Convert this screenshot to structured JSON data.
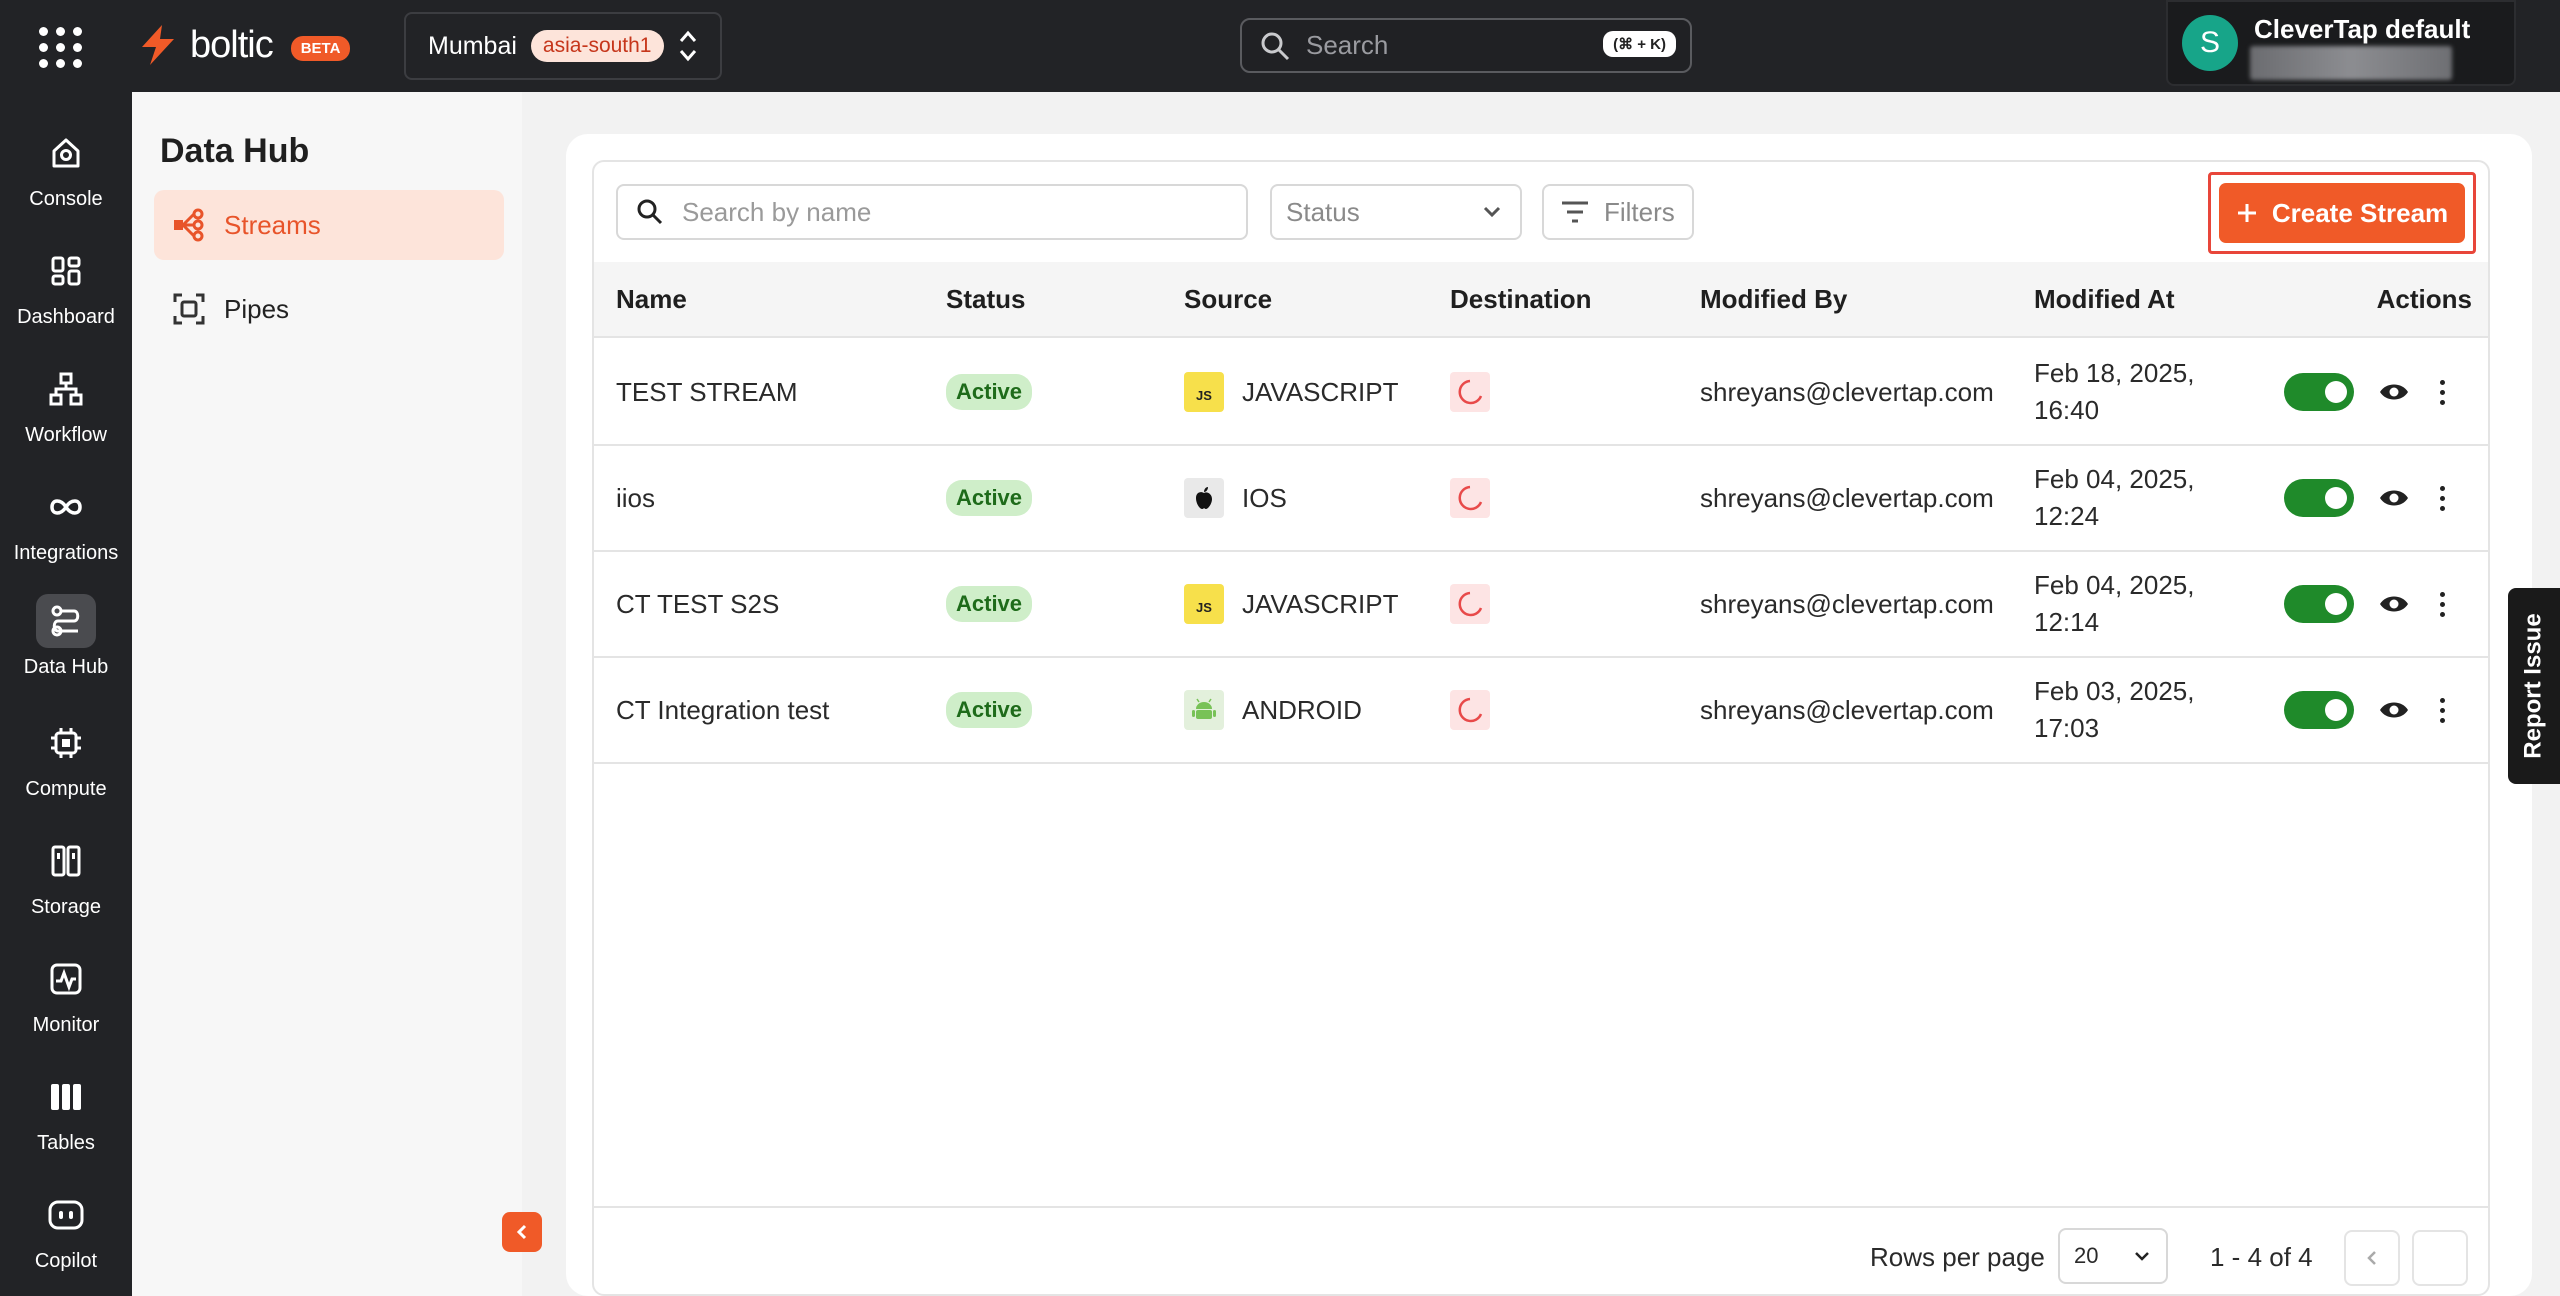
{
  "topbar": {
    "brand": "boltic",
    "beta_label": "BETA",
    "region_name": "Mumbai",
    "region_code": "asia-south1",
    "search_placeholder": "Search",
    "search_shortcut": "(⌘ + K)",
    "account_initial": "S",
    "account_name": "CleverTap default"
  },
  "rail": {
    "items": [
      {
        "label": "Console",
        "icon": "console-icon"
      },
      {
        "label": "Dashboard",
        "icon": "dashboard-icon"
      },
      {
        "label": "Workflow",
        "icon": "workflow-icon"
      },
      {
        "label": "Integrations",
        "icon": "integrations-icon"
      },
      {
        "label": "Data Hub",
        "icon": "data-hub-icon",
        "active": true
      },
      {
        "label": "Compute",
        "icon": "compute-icon"
      },
      {
        "label": "Storage",
        "icon": "storage-icon"
      },
      {
        "label": "Monitor",
        "icon": "monitor-icon"
      },
      {
        "label": "Tables",
        "icon": "tables-icon"
      },
      {
        "label": "Copilot",
        "icon": "copilot-icon"
      }
    ]
  },
  "subnav": {
    "title": "Data Hub",
    "items": [
      {
        "label": "Streams",
        "icon": "streams-icon",
        "active": true
      },
      {
        "label": "Pipes",
        "icon": "pipes-icon"
      }
    ]
  },
  "toolbar": {
    "search_placeholder": "Search by name",
    "status_placeholder": "Status",
    "filters_label": "Filters",
    "create_label": "Create Stream"
  },
  "table": {
    "columns": [
      "Name",
      "Status",
      "Source",
      "Destination",
      "Modified By",
      "Modified At",
      "Actions"
    ],
    "rows": [
      {
        "name": "TEST STREAM",
        "status": "Active",
        "source": "JAVASCRIPT",
        "source_icon": "javascript-icon",
        "modified_by": "shreyans@clevertap.com",
        "modified_at_1": "Feb 18, 2025,",
        "modified_at_2": "16:40",
        "enabled": true
      },
      {
        "name": "iios",
        "status": "Active",
        "source": "IOS",
        "source_icon": "apple-icon",
        "modified_by": "shreyans@clevertap.com",
        "modified_at_1": "Feb 04, 2025,",
        "modified_at_2": "12:24",
        "enabled": true
      },
      {
        "name": "CT TEST S2S",
        "status": "Active",
        "source": "JAVASCRIPT",
        "source_icon": "javascript-icon",
        "modified_by": "shreyans@clevertap.com",
        "modified_at_1": "Feb 04, 2025,",
        "modified_at_2": "12:14",
        "enabled": true
      },
      {
        "name": "CT Integration test",
        "status": "Active",
        "source": "ANDROID",
        "source_icon": "android-icon",
        "modified_by": "shreyans@clevertap.com",
        "modified_at_1": "Feb 03, 2025,",
        "modified_at_2": "17:03",
        "enabled": true
      }
    ]
  },
  "footer": {
    "rows_per_page_label": "Rows per page",
    "rows_per_page_value": "20",
    "range_label": "1 - 4 of 4"
  },
  "report_issue_label": "Report Issue",
  "colors": {
    "accent": "#f05a28",
    "topbar": "#222326",
    "active_badge_bg": "#cfeec9",
    "toggle_on": "#1f8a2a"
  }
}
